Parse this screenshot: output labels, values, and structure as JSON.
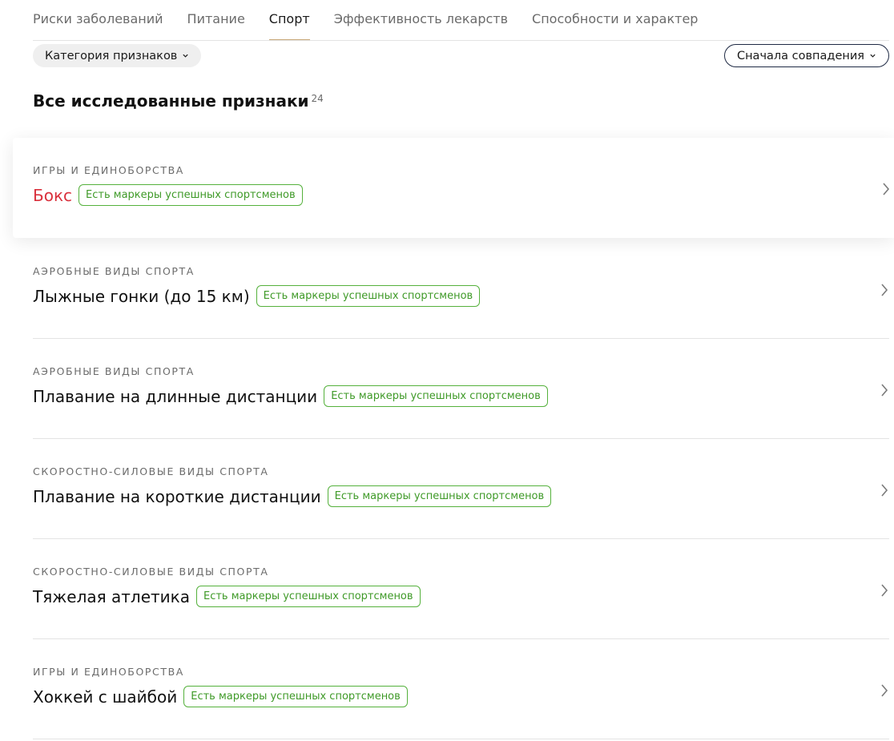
{
  "tabs": [
    {
      "label": "Риски заболеваний",
      "active": false
    },
    {
      "label": "Питание",
      "active": false
    },
    {
      "label": "Спорт",
      "active": true
    },
    {
      "label": "Эффективность лекарств",
      "active": false
    },
    {
      "label": "Способности и характер",
      "active": false
    }
  ],
  "filters": {
    "category_label": "Категория признаков",
    "sort_label": "Сначала совпадения"
  },
  "section": {
    "title": "Все исследованные признаки",
    "count": "24"
  },
  "items": [
    {
      "category": "Игры и единоборства",
      "title": "Бокс",
      "badge": "Есть маркеры успешных спортсменов",
      "highlighted": true
    },
    {
      "category": "Аэробные виды спорта",
      "title": "Лыжные гонки (до 15 км)",
      "badge": "Есть маркеры успешных спортсменов",
      "highlighted": false
    },
    {
      "category": "Аэробные виды спорта",
      "title": "Плавание на длинные дистанции",
      "badge": "Есть маркеры успешных спортсменов",
      "highlighted": false
    },
    {
      "category": "Скоростно-силовые виды спорта",
      "title": "Плавание на короткие дистанции",
      "badge": "Есть маркеры успешных спортсменов",
      "highlighted": false
    },
    {
      "category": "Скоростно-силовые виды спорта",
      "title": "Тяжелая атлетика",
      "badge": "Есть маркеры успешных спортсменов",
      "highlighted": false
    },
    {
      "category": "Игры и единоборства",
      "title": "Хоккей с шайбой",
      "badge": "Есть маркеры успешных спортсменов",
      "highlighted": false
    }
  ],
  "colors": {
    "active_tab_underline": "#c8a878",
    "badge_green": "#3f9a28",
    "highlight_title": "#d9303c"
  },
  "icons": {
    "dropdown": "chevron-down-icon",
    "row_arrow": "chevron-right-icon"
  }
}
